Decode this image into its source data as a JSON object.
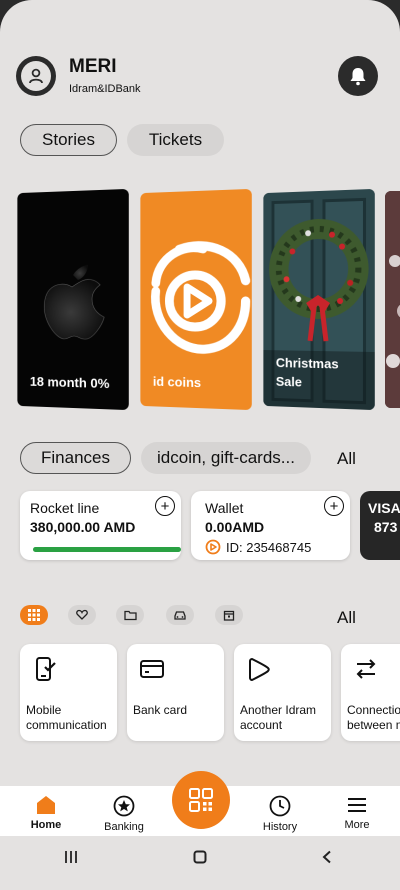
{
  "user": {
    "name": "MERI",
    "subtitle": "Idram&IDBank"
  },
  "story_tabs": [
    {
      "label": "Stories",
      "active": true
    },
    {
      "label": "Tickets",
      "active": false
    }
  ],
  "stories": [
    {
      "label_line1": "18 month 0%",
      "label_line2": ""
    },
    {
      "label_line1": "id coins",
      "label_line2": ""
    },
    {
      "label_line1": "Christmas",
      "label_line2": "Sale"
    }
  ],
  "finance_tabs": [
    {
      "label": "Finances",
      "active": true
    },
    {
      "label": "idcoin, gift-cards...",
      "active": false
    }
  ],
  "finance_all": "All",
  "finance_cards": [
    {
      "title": "Rocket line",
      "amount": "380,000.00 AMD",
      "progress": 1.0
    },
    {
      "title": "Wallet",
      "amount": "0.00AMD",
      "id_text": "ID: 235468745"
    },
    {
      "title": "VISA",
      "amount": "873"
    }
  ],
  "filters": {
    "items": [
      "grid-icon",
      "heart-icon",
      "folder-icon",
      "car-icon",
      "calendar-icon"
    ],
    "active_index": 0,
    "all_label": "All"
  },
  "services": [
    {
      "icon": "mobile-icon",
      "line1": "Mobile",
      "line2": "communication"
    },
    {
      "icon": "card-icon",
      "line1": "Bank card",
      "line2": ""
    },
    {
      "icon": "play-icon",
      "line1": "Another Idram",
      "line2": "account"
    },
    {
      "icon": "transfer-icon",
      "line1": "Connection",
      "line2": "between m"
    }
  ],
  "nav": [
    {
      "label": "Home",
      "icon": "home-icon",
      "active": true
    },
    {
      "label": "Banking",
      "icon": "star-icon",
      "active": false
    },
    {
      "label": "History",
      "icon": "clock-icon",
      "active": false
    },
    {
      "label": "More",
      "icon": "menu-icon",
      "active": false
    }
  ],
  "colors": {
    "accent": "#f07d1a",
    "progress": "#2aa143",
    "background": "#e4e2e1",
    "dark": "#2b2b2b"
  }
}
